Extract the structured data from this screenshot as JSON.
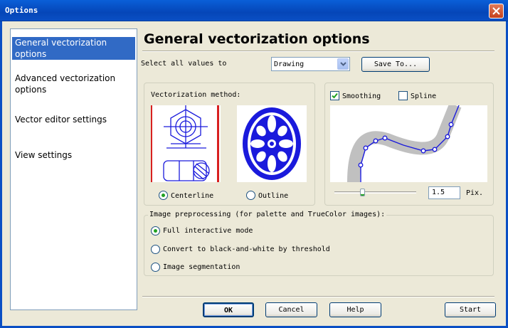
{
  "window": {
    "title": "Options",
    "close_icon": "close-icon"
  },
  "sidebar": {
    "items": [
      {
        "label": "General vectorization options",
        "selected": true
      },
      {
        "label": "Advanced vectorization options",
        "selected": false
      },
      {
        "label": "Vector editor settings",
        "selected": false
      },
      {
        "label": "View settings",
        "selected": false
      }
    ]
  },
  "main": {
    "title": "General vectorization options",
    "select_all_label": "Select all values to",
    "preset_select": {
      "value": "Drawing"
    },
    "save_to_label": "Save To...",
    "vectorization_method": {
      "legend": "Vectorization method:",
      "options": [
        {
          "label": "Centerline",
          "selected": true
        },
        {
          "label": "Outline",
          "selected": false
        }
      ]
    },
    "smoothing": {
      "smoothing_label": "Smoothing",
      "smoothing_checked": true,
      "spline_label": "Spline",
      "spline_checked": false,
      "value": "1.5",
      "unit": "Pix.",
      "slider_level": 0.3
    },
    "preprocessing": {
      "legend": "Image preprocessing (for palette and TrueColor images):",
      "options": [
        {
          "label": "Full interactive mode",
          "selected": true
        },
        {
          "label": "Convert to black-and-white by threshold",
          "selected": false
        },
        {
          "label": "Image segmentation",
          "selected": false
        }
      ]
    }
  },
  "footer": {
    "ok": "OK",
    "cancel": "Cancel",
    "help": "Help",
    "start": "Start"
  },
  "colors": {
    "accent": "#316ac5",
    "titlebar": "#0a4fc4",
    "preview_blue": "#1a1adc",
    "preview_red": "#d82020",
    "radio_dot": "#21a121"
  }
}
